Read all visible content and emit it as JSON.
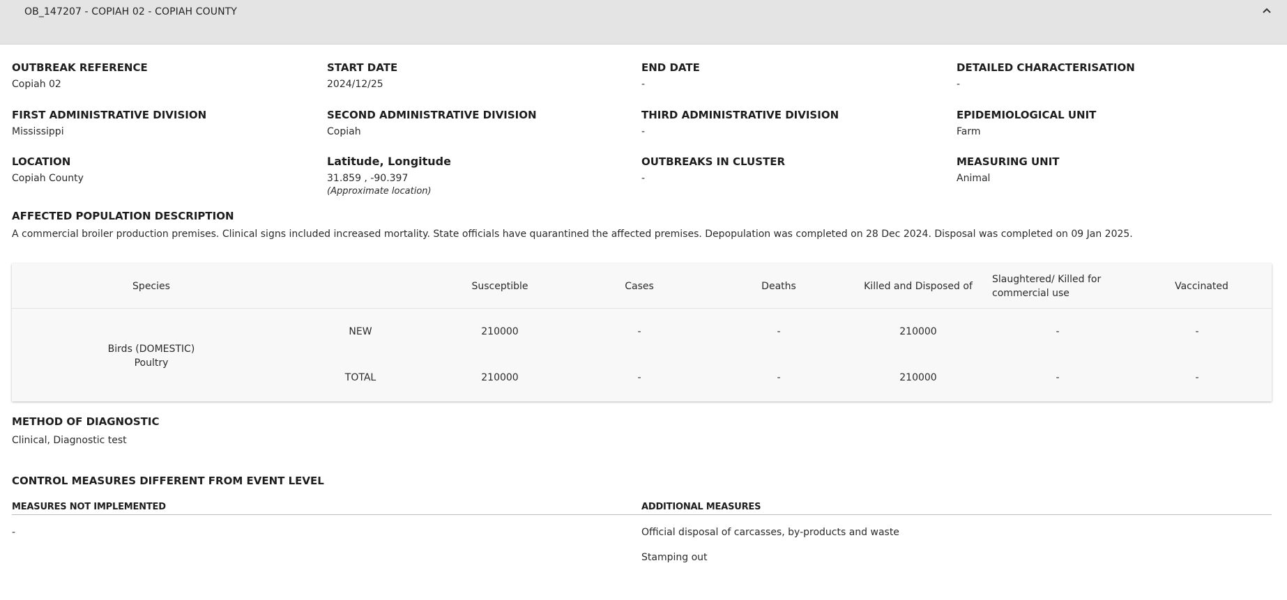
{
  "header": {
    "title": "OB_147207 - COPIAH 02 - COPIAH COUNTY",
    "collapse_icon": "chevron-up-icon"
  },
  "fields": {
    "outbreak_reference": {
      "label": "OUTBREAK REFERENCE",
      "value": "Copiah 02"
    },
    "start_date": {
      "label": "START DATE",
      "value": "2024/12/25"
    },
    "end_date": {
      "label": "END DATE",
      "value": "-"
    },
    "detailed_characterisation": {
      "label": "DETAILED CHARACTERISATION",
      "value": "-"
    },
    "first_admin": {
      "label": "FIRST ADMINISTRATIVE DIVISION",
      "value": "Mississippi"
    },
    "second_admin": {
      "label": "SECOND ADMINISTRATIVE DIVISION",
      "value": "Copiah"
    },
    "third_admin": {
      "label": "THIRD ADMINISTRATIVE DIVISION",
      "value": "-"
    },
    "epi_unit": {
      "label": "EPIDEMIOLOGICAL UNIT",
      "value": "Farm"
    },
    "location": {
      "label": "LOCATION",
      "value": "Copiah County"
    },
    "lat_long": {
      "label": "Latitude, Longitude",
      "value": "31.859 , -90.397",
      "note": "(Approximate location)"
    },
    "outbreaks_in_cluster": {
      "label": "OUTBREAKS IN CLUSTER",
      "value": "-"
    },
    "measuring_unit": {
      "label": "MEASURING UNIT",
      "value": "Animal"
    }
  },
  "affected_population": {
    "label": "AFFECTED POPULATION DESCRIPTION",
    "text": "A commercial broiler production premises. Clinical signs included increased mortality. State officials have quarantined the affected premises. Depopulation was completed on 28 Dec 2024. Disposal was completed on 09 Jan 2025."
  },
  "table": {
    "headers": {
      "species": "Species",
      "susceptible": "Susceptible",
      "cases": "Cases",
      "deaths": "Deaths",
      "killed": "Killed and Disposed of",
      "slaughtered": "Slaughtered/ Killed for commercial use",
      "vaccinated": "Vaccinated"
    },
    "species_line1": "Birds (DOMESTIC)",
    "species_line2": "Poultry",
    "rows": [
      {
        "type": "NEW",
        "susceptible": "210000",
        "cases": "-",
        "deaths": "-",
        "killed": "210000",
        "slaughtered": "-",
        "vaccinated": "-"
      },
      {
        "type": "TOTAL",
        "susceptible": "210000",
        "cases": "-",
        "deaths": "-",
        "killed": "210000",
        "slaughtered": "-",
        "vaccinated": "-"
      }
    ]
  },
  "diagnostic": {
    "label": "METHOD OF DIAGNOSTIC",
    "value": "Clinical, Diagnostic test"
  },
  "control_measures": {
    "title": "CONTROL MEASURES DIFFERENT FROM EVENT LEVEL",
    "not_implemented": {
      "label": "MEASURES NOT IMPLEMENTED",
      "items": [
        "-"
      ]
    },
    "additional": {
      "label": "ADDITIONAL MEASURES",
      "items": [
        "Official disposal of carcasses, by-products and waste",
        "Stamping out"
      ]
    }
  }
}
